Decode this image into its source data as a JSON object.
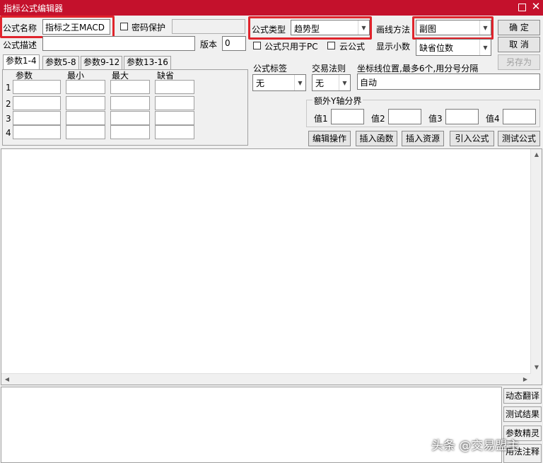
{
  "window": {
    "title": "指标公式编辑器",
    "maximize_icon": "maximize-icon",
    "close_glyph": "✕"
  },
  "formula": {
    "name_label": "公式名称",
    "name_value": "指标之王MACD",
    "password_label": "密码保护",
    "password_checked": false,
    "desc_label": "公式描述",
    "desc_value": "",
    "version_label": "版本",
    "version_value": "0",
    "type_label": "公式类型",
    "type_value": "趋势型",
    "draw_label": "画线方法",
    "draw_value": "副图",
    "pc_only_label": "公式只用于PC",
    "cloud_label": "云公式",
    "decimals_label": "显示小数",
    "decimals_value": "缺省位数"
  },
  "buttons": {
    "ok": "确  定",
    "cancel": "取  消",
    "save_as": "另存为"
  },
  "tabs": [
    "参数1-4",
    "参数5-8",
    "参数9-12",
    "参数13-16"
  ],
  "params": {
    "headers": [
      "参数",
      "最小",
      "最大",
      "缺省"
    ],
    "rows": [
      "1",
      "2",
      "3",
      "4"
    ]
  },
  "tags": {
    "label": "公式标签",
    "value": "无",
    "trade_label": "交易法则",
    "trade_value": "无",
    "axis_label": "坐标线位置,最多6个,用分号分隔",
    "axis_value": "自动"
  },
  "yaxis": {
    "group_label": "额外Y轴分界",
    "labels": [
      "值1",
      "值2",
      "值3",
      "值4"
    ]
  },
  "toolbar": [
    "编辑操作",
    "插入函数",
    "插入资源",
    "引入公式",
    "测试公式"
  ],
  "side_buttons": [
    "动态翻译",
    "测试结果",
    "参数精灵",
    "用法注释"
  ],
  "watermark": "头条 @交易盟主",
  "colors": {
    "titlebar": "#c4112c",
    "highlight": "#e0242c"
  }
}
